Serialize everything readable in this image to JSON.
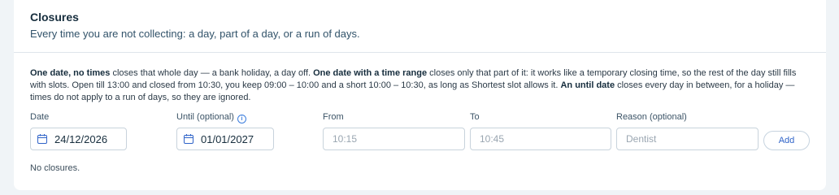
{
  "closures": {
    "title": "Closures",
    "subtitle": "Every time you are not collecting: a day, part of a day, or a run of days.",
    "help": {
      "b1": "One date, no times",
      "t1": " closes that whole day — a bank holiday, a day off. ",
      "b2": "One date with a time range",
      "t2": " closes only that part of it: it works like a temporary closing time, so the rest of the day still fills with slots. Open till 13:00 and closed from 10:30, you keep 09:00 – 10:00 and a short 10:00 – 10:30, as long as Shortest slot allows it. ",
      "b3": "An until date",
      "t3": " closes every day in between, for a holiday — times do not apply to a run of days, so they are ignored."
    },
    "form": {
      "date_label": "Date",
      "date_value": "24/12/2026",
      "until_label": "Until (optional)",
      "until_value": "01/01/2027",
      "from_label": "From",
      "from_placeholder": "10:15",
      "to_label": "To",
      "to_placeholder": "10:45",
      "reason_label": "Reason (optional)",
      "reason_placeholder": "Dentist",
      "add_label": "Add"
    },
    "empty_text": "No closures."
  },
  "icons": {
    "calendar": "calendar-icon",
    "info": "info-icon"
  },
  "colors": {
    "accent": "#2f63c8",
    "page_bg": "#f0f4f7"
  }
}
